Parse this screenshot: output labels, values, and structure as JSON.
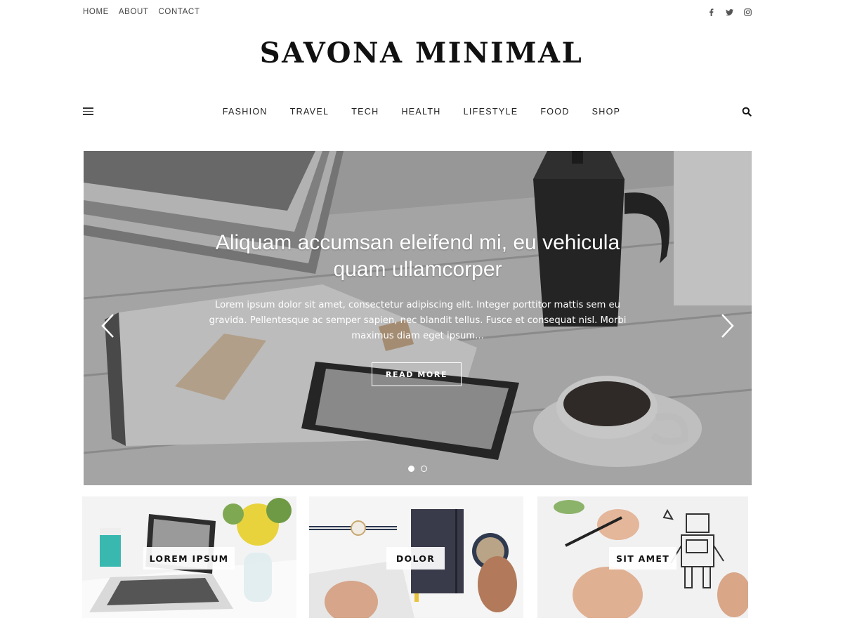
{
  "top_nav": {
    "links": [
      "HOME",
      "ABOUT",
      "CONTACT"
    ],
    "social": [
      "facebook-icon",
      "twitter-icon",
      "instagram-icon"
    ]
  },
  "site": {
    "title": "SAVONA MINIMAL"
  },
  "main_nav": {
    "items": [
      "FASHION",
      "TRAVEL",
      "TECH",
      "HEALTH",
      "LIFESTYLE",
      "FOOD",
      "SHOP"
    ]
  },
  "hero": {
    "title": "Aliquam accumsan eleifend mi, eu vehicula quam ullamcorper",
    "excerpt": "Lorem ipsum dolor sit amet, consectetur adipiscing elit. Integer porttitor mattis sem eu gravida. Pellentesque ac semper sapien, nec blandit tellus. Fusce et consequat nisl. Morbi maximus diam eget ipsum...",
    "button": "READ MORE",
    "slides": 2,
    "active_slide": 1
  },
  "promo_boxes": [
    {
      "label": "LOREM IPSUM"
    },
    {
      "label": "DOLOR"
    },
    {
      "label": "SIT AMET"
    }
  ],
  "colors": {
    "text": "#222222",
    "background": "#ffffff",
    "overlay_text": "#ffffff"
  }
}
